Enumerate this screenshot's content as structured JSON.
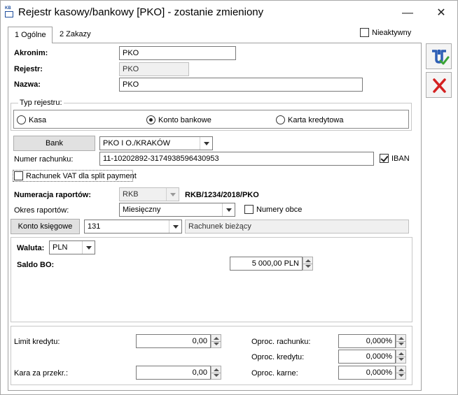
{
  "window": {
    "app_icon_text": "KB",
    "title": "Rejestr kasowy/bankowy [PKO] - zostanie zmieniony",
    "minimize": "—",
    "close": "✕"
  },
  "tabs": [
    {
      "label": "1 Ogólne"
    },
    {
      "label": "2 Zakazy"
    }
  ],
  "inactive": {
    "label": "Nieaktywny",
    "checked": false
  },
  "fields": {
    "akronim_label": "Akronim:",
    "akronim_value": "PKO",
    "rejestr_label": "Rejestr:",
    "rejestr_value": "PKO",
    "nazwa_label": "Nazwa:",
    "nazwa_value": "PKO"
  },
  "register_type": {
    "legend": "Typ rejestru:",
    "options": [
      {
        "label": "Kasa",
        "selected": false
      },
      {
        "label": "Konto bankowe",
        "selected": true
      },
      {
        "label": "Karta kredytowa",
        "selected": false
      }
    ]
  },
  "bank": {
    "button": "Bank",
    "value": "PKO I O./KRAKÓW",
    "account_label": "Numer rachunku:",
    "account_value": "11-10202892-3174938596430953",
    "iban_label": "IBAN",
    "iban_checked": true,
    "vat_label": "Rachunek VAT dla split payment",
    "vat_checked": false
  },
  "numbering": {
    "label": "Numeracja raportów:",
    "value": "RKB",
    "pattern": "RKB/1234/2018/PKO",
    "period_label": "Okres raportów:",
    "period_value": "Miesięczny",
    "obce_label": "Numery obce",
    "obce_checked": false
  },
  "account": {
    "button": "Konto księgowe",
    "value": "131",
    "name": "Rachunek bieżący"
  },
  "currency": {
    "label": "Waluta:",
    "value": "PLN",
    "saldo_label": "Saldo BO:",
    "saldo_value": "5 000,00 PLN"
  },
  "credit": {
    "limit_label": "Limit kredytu:",
    "limit_value": "0,00",
    "kara_label": "Kara za przekr.:",
    "kara_value": "0,00",
    "oproc_rach_label": "Oproc. rachunku:",
    "oproc_rach_value": "0,000%",
    "oproc_kred_label": "Oproc. kredytu:",
    "oproc_kred_value": "0,000%",
    "oproc_karne_label": "Oproc. karne:",
    "oproc_karne_value": "0,000%"
  },
  "side_buttons": {
    "save": "save-icon",
    "cancel": "cancel-icon"
  },
  "colors": {
    "save_blue": "#2e5fb5",
    "save_green": "#3aa335",
    "cancel_red": "#d42020"
  }
}
